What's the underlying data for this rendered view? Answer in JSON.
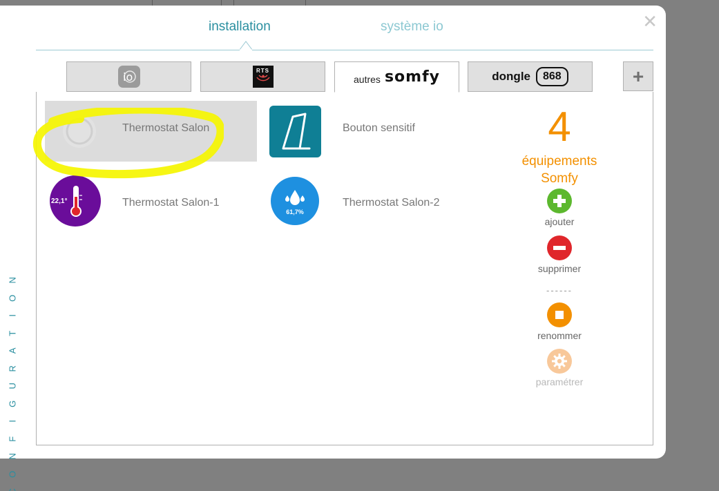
{
  "header": {
    "tabs": [
      {
        "label": "installation",
        "active": true
      },
      {
        "label": "système io",
        "active": false
      }
    ]
  },
  "protocol_tabs": [
    {
      "id": "io",
      "label": "io",
      "icon": "io-icon"
    },
    {
      "id": "rts",
      "label": "RTS",
      "icon": "rts-icon"
    },
    {
      "id": "somfy",
      "prefix": "autres",
      "label": "somfy",
      "active": true
    },
    {
      "id": "dongle",
      "label": "dongle",
      "badge": "868"
    },
    {
      "id": "add",
      "icon": "plus-icon"
    }
  ],
  "devices": [
    {
      "name": "Thermostat Salon",
      "icon": "thermostat-blank-icon",
      "selected": true
    },
    {
      "name": "Bouton sensitif",
      "icon": "touch-button-icon"
    },
    {
      "name": "Thermostat Salon-1",
      "icon": "thermometer-icon",
      "reading": "22,1°"
    },
    {
      "name": "Thermostat Salon-2",
      "icon": "humidity-icon",
      "reading": "61,7%"
    }
  ],
  "summary": {
    "count": "4",
    "label_line1": "équipements",
    "label_line2": "Somfy"
  },
  "actions": [
    {
      "label": "ajouter",
      "icon": "plus-circle-icon",
      "color": "#5cb82e",
      "enabled": true
    },
    {
      "label": "supprimer",
      "icon": "minus-circle-icon",
      "color": "#e0262b",
      "enabled": true
    },
    {
      "label": "renommer",
      "icon": "stop-circle-icon",
      "color": "#f39000",
      "enabled": true
    },
    {
      "label": "paramétrer",
      "icon": "gear-icon",
      "color": "#f8c89a",
      "enabled": false
    }
  ],
  "separator": "------",
  "sidebar": {
    "label": "CONFIGURATION"
  },
  "colors": {
    "accent": "#2a8fa0",
    "orange": "#f39000",
    "highlight": "#f5f500"
  }
}
